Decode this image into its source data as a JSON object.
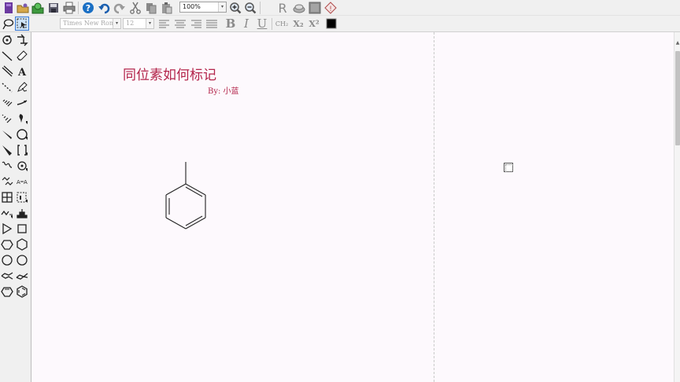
{
  "toolbar": {
    "zoom_value": "100%",
    "zoom_arrow": "▾"
  },
  "format_bar": {
    "font_family": "Times New Roman",
    "font_size": "12",
    "combo_arrow": "▾",
    "bold_label": "B",
    "italic_label": "I",
    "underline_label": "U",
    "formula_label": "CH₂",
    "subscript_label": "X₂",
    "superscript_label": "X²"
  },
  "document": {
    "title": "同位素如何标记",
    "author": "By:  小蓝"
  },
  "colors": {
    "annotation_text": "#b3244a",
    "ui_background": "#f0f0f0",
    "document_background": "#fdf9fd",
    "help_icon": "#1a6fc4"
  },
  "palette_tools": [
    "lasso-tool",
    "marquee-select-tool",
    "rotate-tool",
    "structure-perspective-tool",
    "bond-tool",
    "eraser-tool",
    "multiple-bond-tool",
    "text-tool",
    "dashed-bond-tool",
    "pen-tool",
    "hashed-bond-tool",
    "arrow-tool",
    "hashed-wedge-bond-tool",
    "orbital-tool",
    "wedge-bond-tool",
    "drawing-elements-tool",
    "bold-wedge-bond-tool",
    "bracket-tool",
    "wavy-bond-tool",
    "chemical-symbol-tool",
    "wavy-chain-tool",
    "reaction-mapping-tool",
    "table-tool",
    "query-tool",
    "acyclic-chain-tool",
    "templates-tool",
    "cyclopropane-tool",
    "cyclobutane-tool",
    "cyclopentane-tool",
    "cyclohexane-tool",
    "cycloheptane-tool",
    "cyclooctane-tool",
    "cyclohexane-chair-tool-1",
    "cyclohexane-chair-tool-2",
    "cyclopentadiene-tool",
    "benzene-tool"
  ]
}
